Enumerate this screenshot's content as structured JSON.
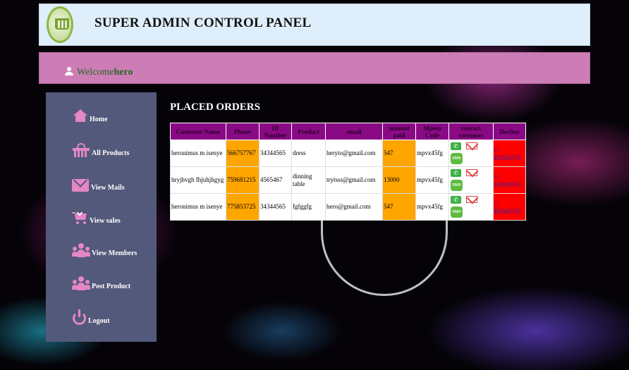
{
  "header": {
    "title": "SUPER ADMIN CONTROL PANEL"
  },
  "welcome": {
    "prefix": "Welcome",
    "username": "hero"
  },
  "sidebar": {
    "items": [
      {
        "label": "Home",
        "icon": "home-icon"
      },
      {
        "label": "All Products",
        "icon": "basket-icon"
      },
      {
        "label": "View Mails",
        "icon": "envelope-icon"
      },
      {
        "label": "View sales",
        "icon": "cart-icon"
      },
      {
        "label": "View Members",
        "icon": "users-icon"
      },
      {
        "label": "Post Product",
        "icon": "users-icon"
      },
      {
        "label": "Logout",
        "icon": "power-icon"
      }
    ]
  },
  "page_title": "PLACED ORDERS",
  "orders": {
    "headers": [
      "Customer Name",
      "Phone",
      "ID Number",
      "Product",
      "email",
      "amount paid",
      "Mpesa Code",
      "contact customer",
      "Decline"
    ],
    "rows": [
      {
        "name": "heronimus m isenye",
        "phone": "566757767",
        "id_number": "34344565",
        "product": "dress",
        "email": "heryto@gmail.com",
        "amount": "547",
        "mpesa": "mpvx45fg",
        "decline": "REMOVE"
      },
      {
        "name": "hryjhvgh fhjuhjhgyg",
        "phone": "759681215",
        "id_number": "4565467",
        "product": "dinning table",
        "email": "trytsss@gmail.com",
        "amount": "13000",
        "mpesa": "mpvx45fg",
        "decline": "REMOVE"
      },
      {
        "name": "heronimus m isenye",
        "phone": "775853725",
        "id_number": "34344565",
        "product": "fgfggfg",
        "email": "hero@gmail.com",
        "amount": "547",
        "mpesa": "mpvx45fg",
        "decline": "REMOVE"
      }
    ]
  },
  "colors": {
    "header_bg": "#deeefa",
    "welcome_bg": "#cd7db6",
    "sidebar_bg": "#53597a",
    "icon_pink": "#e487c5",
    "table_header": "#8a0a86",
    "highlight_orange": "#ffa500",
    "decline_red": "#ff0000"
  }
}
